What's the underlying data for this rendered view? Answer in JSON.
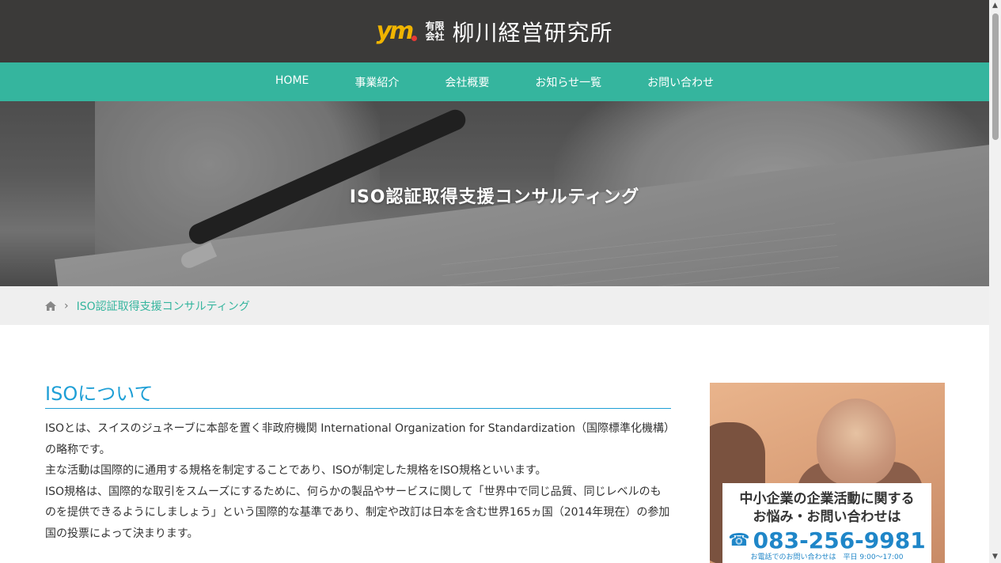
{
  "header": {
    "logo_mark": "ym",
    "company_type_line1": "有限",
    "company_type_line2": "会社",
    "company_name": "柳川経営研究所"
  },
  "nav": {
    "items": [
      {
        "label": "HOME"
      },
      {
        "label": "事業紹介"
      },
      {
        "label": "会社概要"
      },
      {
        "label": "お知らせ一覧"
      },
      {
        "label": "お問い合わせ"
      }
    ]
  },
  "hero": {
    "title": "ISO認証取得支援コンサルティング"
  },
  "breadcrumb": {
    "home_icon": "home-icon",
    "separator": "›",
    "current": "ISO認証取得支援コンサルティング"
  },
  "main": {
    "section_title": "ISOについて",
    "paragraphs": [
      "ISOとは、スイスのジュネーブに本部を置く非政府機関 International Organization for Standardization（国際標準化機構）の略称です。",
      "主な活動は国際的に通用する規格を制定することであり、ISOが制定した規格をISO規格といいます。",
      "ISO規格は、国際的な取引をスムーズにするために、何らかの製品やサービスに関して「世界中で同じ品質、同じレベルのものを提供できるようにしましょう」という国際的な基準であり、制定や改訂は日本を含む世界165ヵ国（2014年現在）の参加国の投票によって決まります。"
    ]
  },
  "sidebar": {
    "banner": {
      "line1": "中小企業の企業活動に関する",
      "line2": "お悩み・お問い合わせは",
      "phone_icon": "☎",
      "phone": "083-256-9981",
      "note": "お電話でのお問い合わせは　平日 9:00～17:00"
    }
  },
  "colors": {
    "header_bg": "#3b3a39",
    "nav_bg": "#35b59e",
    "accent_blue": "#1e9fd6",
    "breadcrumb_link": "#35b59e",
    "phone_blue": "#1f86c8"
  },
  "scrollbar": {
    "up_arrow": "▲",
    "down_arrow": "▼"
  }
}
